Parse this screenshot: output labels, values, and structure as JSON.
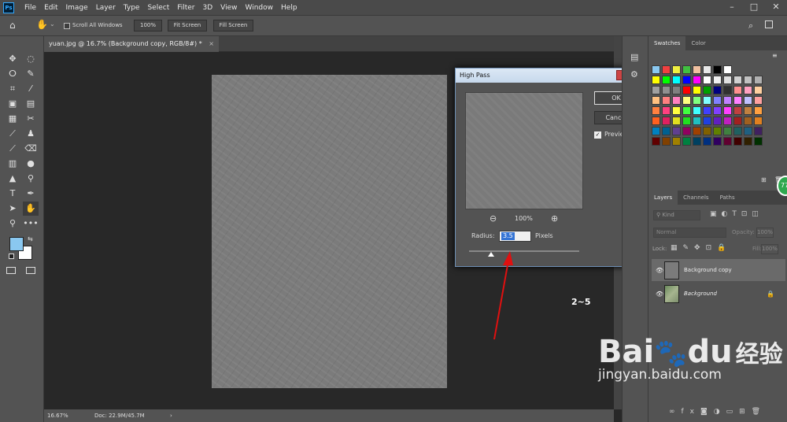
{
  "app": {
    "logo": "Ps",
    "menu": [
      "File",
      "Edit",
      "Image",
      "Layer",
      "Type",
      "Select",
      "Filter",
      "3D",
      "View",
      "Window",
      "Help"
    ],
    "window_controls": [
      "–",
      "□",
      "✕"
    ]
  },
  "options": {
    "scroll_all": "Scroll All Windows",
    "zoom_value": "100%",
    "fit_screen": "Fit Screen",
    "fill_screen": "Fill Screen"
  },
  "document": {
    "tab_title": "yuan.jpg @ 16.7% (Background copy, RGB/8#) *",
    "tab_close": "×",
    "zoom": "16.67%",
    "doc_size": "Doc: 22.9M/45.7M",
    "status_arrow": "›"
  },
  "dialog": {
    "title": "High Pass",
    "close": "✕",
    "ok": "OK",
    "cancel": "Cancel",
    "preview_label": "Preview",
    "preview_checked": true,
    "preview_zoom": "100%",
    "zoom_out": "−",
    "zoom_in": "+",
    "radius_label": "Radius:",
    "radius_value": "3.5",
    "units": "Pixels",
    "radius_slider_fraction": 0.2
  },
  "annotation": {
    "text": "2~5",
    "arrow_color": "#e01010"
  },
  "swatches_panel": {
    "tabs": [
      "Swatches",
      "Color"
    ],
    "colors": [
      [
        "#8ac8f0",
        "#f04040",
        "#f0f040",
        "#40c040",
        "#f0c0a0",
        "#e8e8e8",
        "#000000",
        "#ffffff"
      ],
      [
        "#ffff00",
        "#00ff00",
        "#00ffff",
        "#0000ff",
        "#ff00ff",
        "#ffffff",
        "#f0f0f0",
        "#e0e0e0",
        "#d0d0d0",
        "#c0c0c0",
        "#b0b0b0"
      ],
      [
        "#a0a0a0",
        "#909090",
        "#808080",
        "#ff0000",
        "#ffff00",
        "#00a000",
        "#000080",
        "#303030",
        "#ff9090",
        "#ffa0c0",
        "#ffd0a0"
      ],
      [
        "#ffc080",
        "#ff8080",
        "#ff80c0",
        "#ffff80",
        "#80ff80",
        "#80ffff",
        "#8080ff",
        "#c080ff",
        "#ff80ff",
        "#c0c0ff",
        "#ffa0a0"
      ],
      [
        "#ff8040",
        "#ff4080",
        "#ffff40",
        "#40ff40",
        "#40ffff",
        "#4040ff",
        "#8040ff",
        "#ff40ff",
        "#c04040",
        "#c08040",
        "#ffa040"
      ],
      [
        "#ff6020",
        "#e02060",
        "#e0e020",
        "#20e020",
        "#20c0c0",
        "#2040e0",
        "#6020c0",
        "#c020c0",
        "#a02020",
        "#a06020",
        "#e08020"
      ],
      [
        "#0080c0",
        "#006090",
        "#604090",
        "#900060",
        "#a04000",
        "#806000",
        "#608000",
        "#408040",
        "#206060",
        "#206080",
        "#402060"
      ],
      [
        "#600000",
        "#804000",
        "#a08000",
        "#008040",
        "#004060",
        "#003080",
        "#300060",
        "#600030",
        "#400000",
        "#302000",
        "#003000"
      ]
    ]
  },
  "layers_panel": {
    "tabs": [
      "Layers",
      "Channels",
      "Paths"
    ],
    "filter_kind": "Kind",
    "blend_mode": "Normal",
    "opacity_label": "Opacity:",
    "opacity_value": "100%",
    "lock_label": "Lock:",
    "fill_label": "Fill:",
    "fill_value": "100%",
    "layers": [
      {
        "name": "Background copy",
        "selected": true,
        "locked": false
      },
      {
        "name": "Background",
        "selected": false,
        "locked": true
      }
    ]
  },
  "watermark": {
    "brand": "Bai",
    "brand2": "du",
    "cn": "经验",
    "url": "jingyan.baidu.com"
  },
  "badge": "77"
}
